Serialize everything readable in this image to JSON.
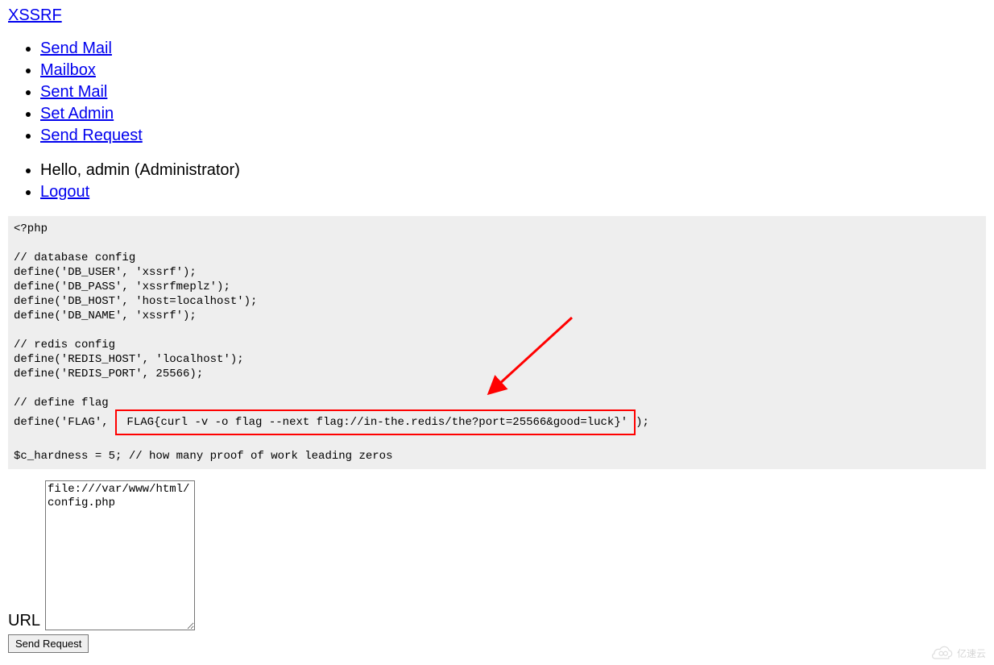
{
  "brand": "XSSRF",
  "nav": {
    "items": [
      {
        "label": "Send Mail"
      },
      {
        "label": "Mailbox"
      },
      {
        "label": "Sent Mail"
      },
      {
        "label": "Set Admin"
      },
      {
        "label": "Send Request"
      }
    ]
  },
  "status": {
    "greeting": "Hello, admin (Administrator)",
    "logout": "Logout"
  },
  "code": {
    "line1": "<?php",
    "line2": "",
    "line3": "// database config",
    "line4": "define('DB_USER', 'xssrf');",
    "line5": "define('DB_PASS', 'xssrfmeplz');",
    "line6": "define('DB_HOST', 'host=localhost');",
    "line7": "define('DB_NAME', 'xssrf');",
    "line8": "",
    "line9": "// redis config",
    "line10": "define('REDIS_HOST', 'localhost');",
    "line11": "define('REDIS_PORT', 25566);",
    "line12": "",
    "line13": "// define flag",
    "line14_pre": "define('FLAG', ",
    "line14_flag": " FLAG{curl -v -o flag --next flag://in-the.redis/the?port=25566&good=luck}'",
    "line14_post": ");",
    "line15": "",
    "line16": "$c_hardness = 5; // how many proof of work leading zeros"
  },
  "form": {
    "url_label": "URL",
    "url_value": "file:///var/www/html/config.php",
    "submit_label": "Send Request"
  },
  "watermark": {
    "text": "亿速云"
  }
}
